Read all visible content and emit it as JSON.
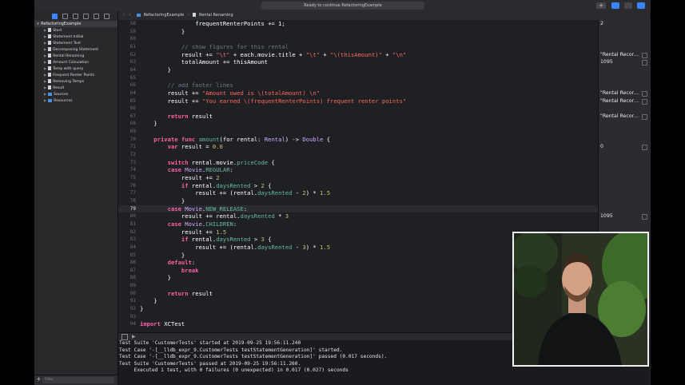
{
  "toolbar": {
    "status": "Ready to continue RefactoringExample",
    "add_label": "+"
  },
  "sidebar": {
    "root": "RefactoringExample",
    "items": [
      {
        "label": "Start"
      },
      {
        "label": "Statement Initial"
      },
      {
        "label": "Statement Text"
      },
      {
        "label": "Decomposing Statement"
      },
      {
        "label": "Rental Renaming"
      },
      {
        "label": "Amount Calculation"
      },
      {
        "label": "Temp with query"
      },
      {
        "label": "Frequent Renter Points"
      },
      {
        "label": "Removing Temps"
      },
      {
        "label": "Result"
      },
      {
        "label": "Sources"
      },
      {
        "label": "Resources"
      }
    ],
    "filter_placeholder": "Filter",
    "add_label": "+"
  },
  "jumpbar": {
    "project": "RefactoringExample",
    "page": "Rental Renaming"
  },
  "editor": {
    "lines": [
      {
        "n": "58",
        "tokens": [
          {
            "c": "pl",
            "t": "                frequentRenterPoints += 1;"
          }
        ]
      },
      {
        "n": "59",
        "tokens": [
          {
            "c": "pl",
            "t": "            }"
          }
        ]
      },
      {
        "n": "60",
        "tokens": [
          {
            "c": "pl",
            "t": ""
          }
        ]
      },
      {
        "n": "61",
        "tokens": [
          {
            "c": "c",
            "t": "            // show figures for this rental"
          }
        ]
      },
      {
        "n": "62",
        "tokens": [
          {
            "c": "pl",
            "t": "            result += "
          },
          {
            "c": "s",
            "t": "\"\\t\""
          },
          {
            "c": "pl",
            "t": " + each.movie.title + "
          },
          {
            "c": "s",
            "t": "\"\\t\""
          },
          {
            "c": "pl",
            "t": " + "
          },
          {
            "c": "s",
            "t": "\"\\(thisAmount)\""
          },
          {
            "c": "pl",
            "t": " + "
          },
          {
            "c": "s",
            "t": "\"\\n\""
          }
        ]
      },
      {
        "n": "63",
        "tokens": [
          {
            "c": "pl",
            "t": "            totalAmount += thisAmount"
          }
        ]
      },
      {
        "n": "64",
        "tokens": [
          {
            "c": "pl",
            "t": "        }"
          }
        ]
      },
      {
        "n": "65",
        "tokens": [
          {
            "c": "pl",
            "t": ""
          }
        ]
      },
      {
        "n": "66",
        "tokens": [
          {
            "c": "c",
            "t": "        // add footer lines"
          }
        ]
      },
      {
        "n": "64",
        "tokens": [
          {
            "c": "pl",
            "t": "        result += "
          },
          {
            "c": "s",
            "t": "\"Amount owed is \\(totalAmount) \\n\""
          }
        ]
      },
      {
        "n": "65",
        "tokens": [
          {
            "c": "pl",
            "t": "        result += "
          },
          {
            "c": "s",
            "t": "\"You earned \\(frequentRenterPoints) frequent renter points\""
          }
        ]
      },
      {
        "n": "66",
        "tokens": [
          {
            "c": "pl",
            "t": ""
          }
        ]
      },
      {
        "n": "67",
        "tokens": [
          {
            "c": "k",
            "t": "        return"
          },
          {
            "c": "pl",
            "t": " result"
          }
        ]
      },
      {
        "n": "68",
        "tokens": [
          {
            "c": "pl",
            "t": "    }"
          }
        ]
      },
      {
        "n": "69",
        "tokens": [
          {
            "c": "pl",
            "t": ""
          }
        ]
      },
      {
        "n": "70",
        "tokens": [
          {
            "c": "k",
            "t": "    private func "
          },
          {
            "c": "f",
            "t": "amount"
          },
          {
            "c": "pl",
            "t": "(for rental: "
          },
          {
            "c": "t",
            "t": "Rental"
          },
          {
            "c": "pl",
            "t": ") -> "
          },
          {
            "c": "t",
            "t": "Double"
          },
          {
            "c": "pl",
            "t": " {"
          }
        ]
      },
      {
        "n": "71",
        "tokens": [
          {
            "c": "k",
            "t": "        var"
          },
          {
            "c": "pl",
            "t": " result = "
          },
          {
            "c": "n",
            "t": "0.0"
          }
        ]
      },
      {
        "n": "72",
        "tokens": [
          {
            "c": "pl",
            "t": ""
          }
        ]
      },
      {
        "n": "73",
        "tokens": [
          {
            "c": "k",
            "t": "        switch"
          },
          {
            "c": "pl",
            "t": " rental.movie."
          },
          {
            "c": "f",
            "t": "priceCode"
          },
          {
            "c": "pl",
            "t": " {"
          }
        ]
      },
      {
        "n": "74",
        "tokens": [
          {
            "c": "k",
            "t": "        case "
          },
          {
            "c": "t",
            "t": "Movie"
          },
          {
            "c": "pl",
            "t": "."
          },
          {
            "c": "f",
            "t": "REGULAR"
          },
          {
            "c": "pl",
            "t": ":"
          }
        ]
      },
      {
        "n": "75",
        "tokens": [
          {
            "c": "pl",
            "t": "            result += "
          },
          {
            "c": "n",
            "t": "2"
          }
        ]
      },
      {
        "n": "76",
        "tokens": [
          {
            "c": "k",
            "t": "            if"
          },
          {
            "c": "pl",
            "t": " rental."
          },
          {
            "c": "f",
            "t": "daysRented"
          },
          {
            "c": "pl",
            "t": " > "
          },
          {
            "c": "n",
            "t": "2"
          },
          {
            "c": "pl",
            "t": " {"
          }
        ]
      },
      {
        "n": "77",
        "tokens": [
          {
            "c": "pl",
            "t": "                result += (rental."
          },
          {
            "c": "f",
            "t": "daysRented"
          },
          {
            "c": "pl",
            "t": " - "
          },
          {
            "c": "n",
            "t": "2"
          },
          {
            "c": "pl",
            "t": ") * "
          },
          {
            "c": "n",
            "t": "1.5"
          }
        ]
      },
      {
        "n": "78",
        "tokens": [
          {
            "c": "pl",
            "t": "            }"
          }
        ]
      },
      {
        "n": "79",
        "tokens": [
          {
            "c": "k",
            "t": "        case "
          },
          {
            "c": "t",
            "t": "Movie"
          },
          {
            "c": "pl",
            "t": "."
          },
          {
            "c": "f",
            "t": "NEW_RELEASE"
          },
          {
            "c": "pl",
            "t": ":"
          }
        ]
      },
      {
        "n": "80",
        "tokens": [
          {
            "c": "pl",
            "t": "            result += rental."
          },
          {
            "c": "f",
            "t": "daysRented"
          },
          {
            "c": "pl",
            "t": " * "
          },
          {
            "c": "n",
            "t": "3"
          }
        ]
      },
      {
        "n": "81",
        "tokens": [
          {
            "c": "k",
            "t": "        case "
          },
          {
            "c": "t",
            "t": "Movie"
          },
          {
            "c": "pl",
            "t": "."
          },
          {
            "c": "f",
            "t": "CHILDREN"
          },
          {
            "c": "pl",
            "t": ":"
          }
        ]
      },
      {
        "n": "82",
        "tokens": [
          {
            "c": "pl",
            "t": "            result += "
          },
          {
            "c": "n",
            "t": "1.5"
          }
        ]
      },
      {
        "n": "83",
        "tokens": [
          {
            "c": "k",
            "t": "            if"
          },
          {
            "c": "pl",
            "t": " rental."
          },
          {
            "c": "f",
            "t": "daysRented"
          },
          {
            "c": "pl",
            "t": " > "
          },
          {
            "c": "n",
            "t": "3"
          },
          {
            "c": "pl",
            "t": " {"
          }
        ]
      },
      {
        "n": "84",
        "tokens": [
          {
            "c": "pl",
            "t": "                result += (rental."
          },
          {
            "c": "f",
            "t": "daysRented"
          },
          {
            "c": "pl",
            "t": " - "
          },
          {
            "c": "n",
            "t": "3"
          },
          {
            "c": "pl",
            "t": ") * "
          },
          {
            "c": "n",
            "t": "1.5"
          }
        ]
      },
      {
        "n": "85",
        "tokens": [
          {
            "c": "pl",
            "t": "            }"
          }
        ]
      },
      {
        "n": "86",
        "tokens": [
          {
            "c": "k",
            "t": "        default"
          },
          {
            "c": "pl",
            "t": ":"
          }
        ]
      },
      {
        "n": "87",
        "tokens": [
          {
            "c": "k",
            "t": "            break"
          }
        ]
      },
      {
        "n": "88",
        "tokens": [
          {
            "c": "pl",
            "t": "        }"
          }
        ]
      },
      {
        "n": "89",
        "tokens": [
          {
            "c": "pl",
            "t": ""
          }
        ]
      },
      {
        "n": "90",
        "tokens": [
          {
            "c": "k",
            "t": "        return"
          },
          {
            "c": "pl",
            "t": " result"
          }
        ]
      },
      {
        "n": "91",
        "tokens": [
          {
            "c": "pl",
            "t": "    }"
          }
        ]
      },
      {
        "n": "92",
        "tokens": [
          {
            "c": "pl",
            "t": "}"
          }
        ]
      },
      {
        "n": "93",
        "tokens": [
          {
            "c": "pl",
            "t": ""
          }
        ]
      },
      {
        "n": "94",
        "tokens": [
          {
            "c": "k",
            "t": "import"
          },
          {
            "c": "pl",
            "t": " XCTest"
          }
        ]
      }
    ],
    "highlighted_line": "79"
  },
  "results": [
    {
      "line": "58",
      "text": "2",
      "button": false
    },
    {
      "line": "62",
      "text": "\"Rental Record for martin\\n\\tRan 3.5\\n\"",
      "button": true
    },
    {
      "line": "63",
      "text": "1095",
      "button": true
    },
    {
      "line": "64b",
      "text": "\"Rental Record for martin\"",
      "button": true
    },
    {
      "line": "65b",
      "text": "\"Rental Record for martin\"",
      "button": true
    },
    {
      "line": "67",
      "text": "\"Rental Record for martin\"",
      "button": true
    },
    {
      "line": "71",
      "text": "0",
      "button": true
    },
    {
      "line": "80",
      "text": "1095",
      "button": true
    }
  ],
  "console": {
    "lines": [
      "Test Suite 'CustomerTests' started at 2019-09-25 19:56:11.240",
      "Test Case '-[__lldb_expr_9.CustomerTests testStatementGeneration]' started.",
      "Test Case '-[__lldb_expr_9.CustomerTests testStatementGeneration]' passed (0.017 seconds).",
      "Test Suite 'CustomerTests' passed at 2019-09-25 19:56:11.260.",
      "     Executed 1 test, with 0 failures (0 unexpected) in 0.017 (0.027) seconds"
    ]
  },
  "colors": {
    "accent": "#3a86ff",
    "keyword": "#fc5fa3",
    "string": "#fc6a5d",
    "number": "#d0bf69",
    "comment": "#6c7986"
  }
}
